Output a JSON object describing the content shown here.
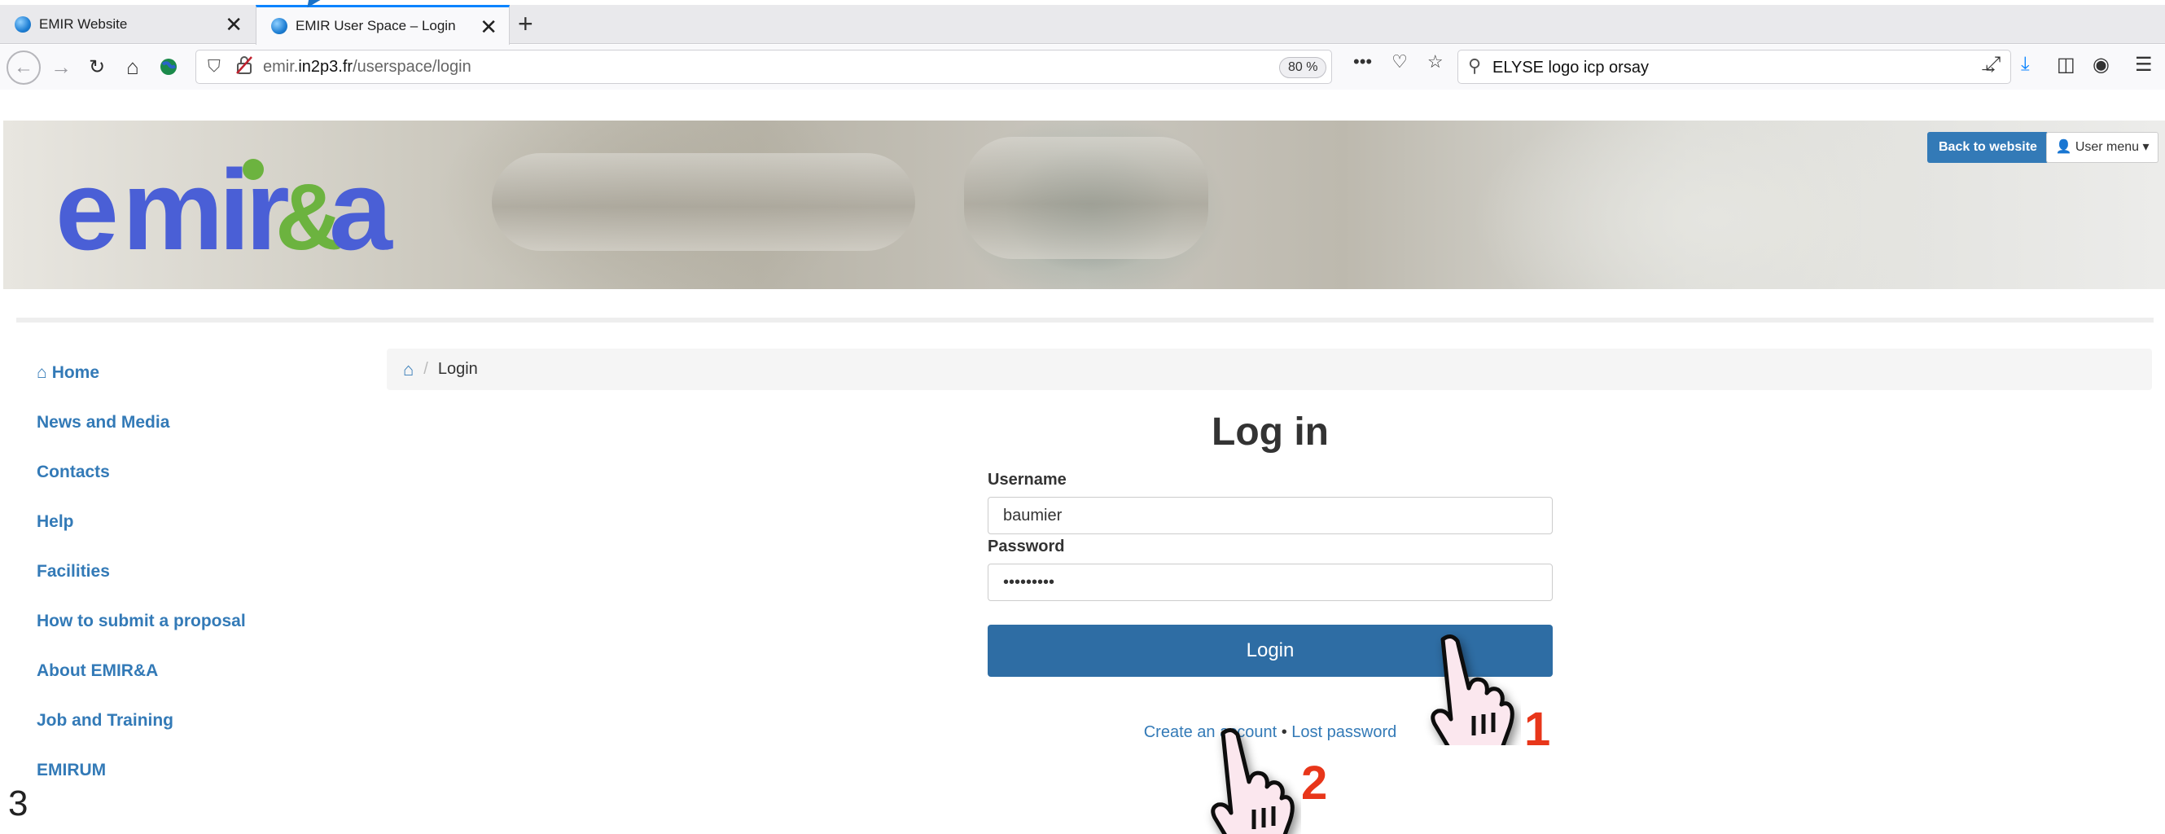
{
  "browser": {
    "tabs": [
      {
        "title": "EMIR Website",
        "active": false
      },
      {
        "title": "EMIR User Space – Login",
        "active": true
      }
    ],
    "new_tab_icon": "plus-icon",
    "url_prefix": "emir.",
    "url_domain": "in2p3.fr",
    "url_path": "/userspace/login",
    "zoom": "80 %",
    "search_text": "ELYSE logo icp orsay"
  },
  "site": {
    "logo_text": "emir&a",
    "back_to_website": "Back to website",
    "user_menu": "User menu"
  },
  "sidebar": {
    "items": [
      {
        "label": "Home"
      },
      {
        "label": "News and Media"
      },
      {
        "label": "Contacts"
      },
      {
        "label": "Help"
      },
      {
        "label": "Facilities"
      },
      {
        "label": "How to submit a proposal"
      },
      {
        "label": "About EMIR&A"
      },
      {
        "label": "Job and Training"
      },
      {
        "label": "EMIRUM"
      }
    ]
  },
  "breadcrumb": {
    "current": "Login"
  },
  "login": {
    "title": "Log in",
    "username_label": "Username",
    "username_value": "baumier",
    "password_label": "Password",
    "password_value": "•••••••••",
    "submit_label": "Login",
    "create_account": "Create an account",
    "separator": "•",
    "lost_password": "Lost password"
  },
  "annotations": {
    "step1": "1",
    "step2": "2",
    "slide_number": "3"
  },
  "colors": {
    "link": "#337ab7",
    "primary_button": "#2e6da4",
    "step_number": "#e8361a",
    "logo_blue": "#4a5fd6",
    "logo_green": "#6cb33f"
  }
}
